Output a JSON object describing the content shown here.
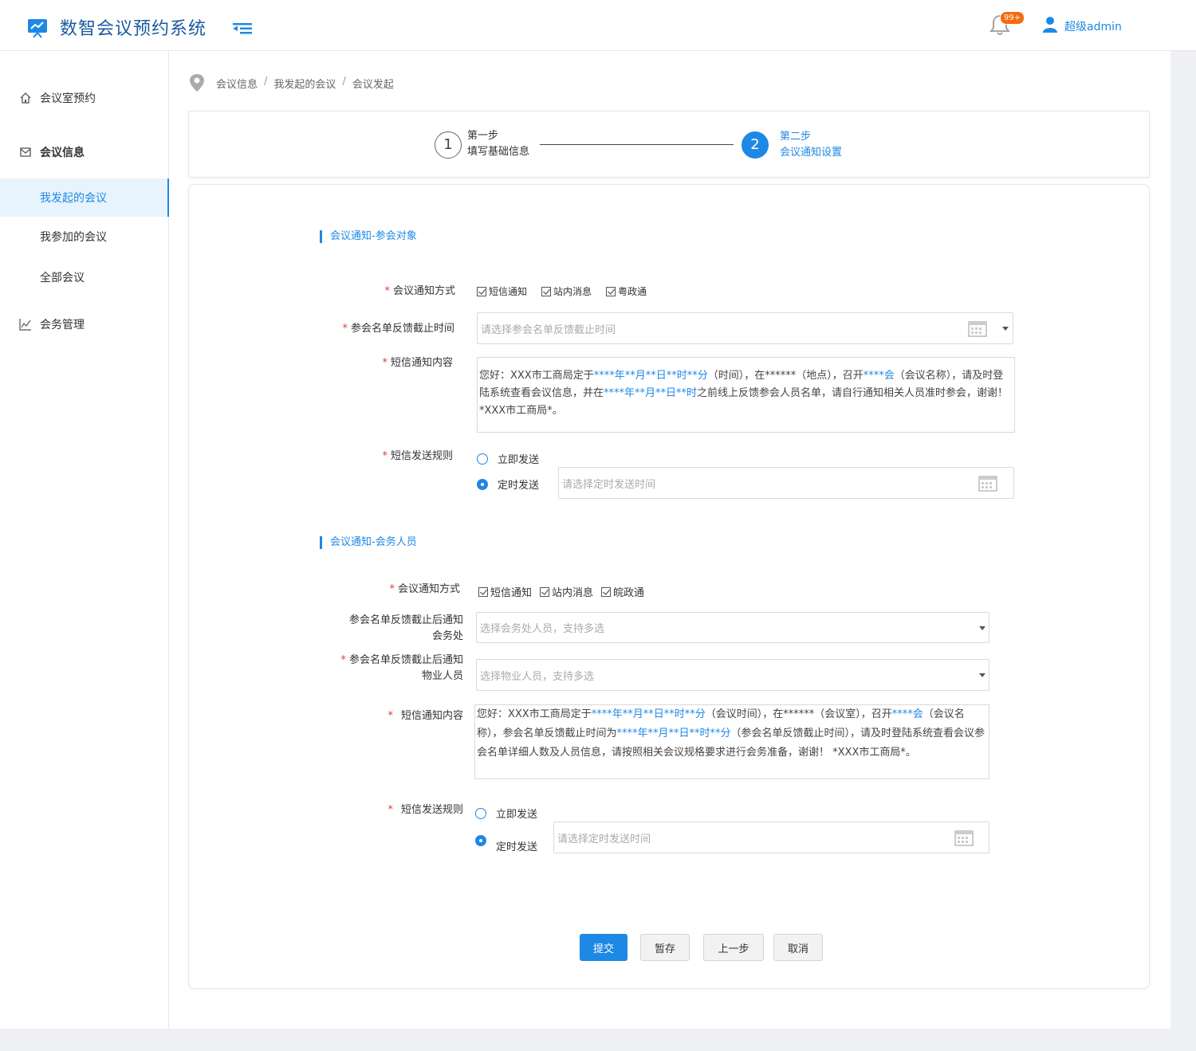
{
  "header": {
    "app_title": "数智会议预约系统",
    "notification_badge": "99+",
    "user_name": "超级admin"
  },
  "sidebar": {
    "items": [
      {
        "label": "会议室预约"
      },
      {
        "label": "会议信息"
      },
      {
        "label": "我发起的会议"
      },
      {
        "label": "我参加的会议"
      },
      {
        "label": "全部会议"
      },
      {
        "label": "会务管理"
      }
    ]
  },
  "breadcrumb": {
    "items": [
      "会议信息",
      "我发起的会议",
      "会议发起"
    ],
    "separator": "/"
  },
  "steps": {
    "step1": {
      "number": "1",
      "title": "第一步",
      "desc": "填写基础信息"
    },
    "step2": {
      "number": "2",
      "title": "第二步",
      "desc": "会议通知设置"
    }
  },
  "section1": {
    "title": "会议通知-参会对象",
    "notify_method_label": "会议通知方式",
    "notify_options": [
      "短信通知",
      "站内消息",
      "粤政通"
    ],
    "deadline_label": "参会名单反馈截止时间",
    "deadline_placeholder": "请选择参会名单反馈截止时间",
    "sms_content_label": "短信通知内容",
    "sms_content": {
      "p1": "您好：XXX市工商局定于",
      "h1": "****年**月**日**时**分",
      "p2": "（时间），在******（地点），召开",
      "h2": "****会",
      "p3": "（会议名称），请及时登陆系统查看会议信息，并在",
      "h3": "****年**月**日**时",
      "p4": "之前线上反馈参会人员名单，请自行通知相关人员准时参会，谢谢！ *XXX市工商局*。"
    },
    "send_rule_label": "短信发送规则",
    "send_now": "立即发送",
    "send_scheduled": "定时发送",
    "scheduled_placeholder": "请选择定时发送时间"
  },
  "section2": {
    "title": "会议通知-会务人员",
    "notify_method_label": "会议通知方式",
    "notify_options": [
      "短信通知",
      "站内消息",
      "皖政通"
    ],
    "affairs_label_1": "参会名单反馈截止后通知",
    "affairs_label_2": "会务处",
    "affairs_placeholder": "选择会务处人员，支持多选",
    "property_label_1": "参会名单反馈截止后通知",
    "property_label_2": "物业人员",
    "property_placeholder": "选择物业人员，支持多选",
    "sms_content_label": "短信通知内容",
    "sms_content": {
      "p1": "您好：XXX市工商局定于",
      "h1": "****年**月**日**时**分",
      "p2": "（会议时间），在******（会议室），召开",
      "h2": "****会",
      "p3": "（会议名称），参会名单反馈截止时间为",
      "h3": "****年**月**日**时**分",
      "p4": "（参会名单反馈截止时间），请及时登陆系统查看会议参会名单详细人数及人员信息，请按照相关会议规格要求进行会务准备，谢谢！ *XXX市工商局*。"
    },
    "send_rule_label": "短信发送规则",
    "send_now": "立即发送",
    "send_scheduled": "定时发送",
    "scheduled_placeholder": "请选择定时发送时间"
  },
  "actions": {
    "submit": "提交",
    "save_draft": "暂存",
    "prev_step": "上一步",
    "cancel": "取消"
  },
  "colors": {
    "accent": "#1e88e5",
    "title": "#1a5aa0",
    "badge": "#f26c0d",
    "required": "#e53935"
  }
}
